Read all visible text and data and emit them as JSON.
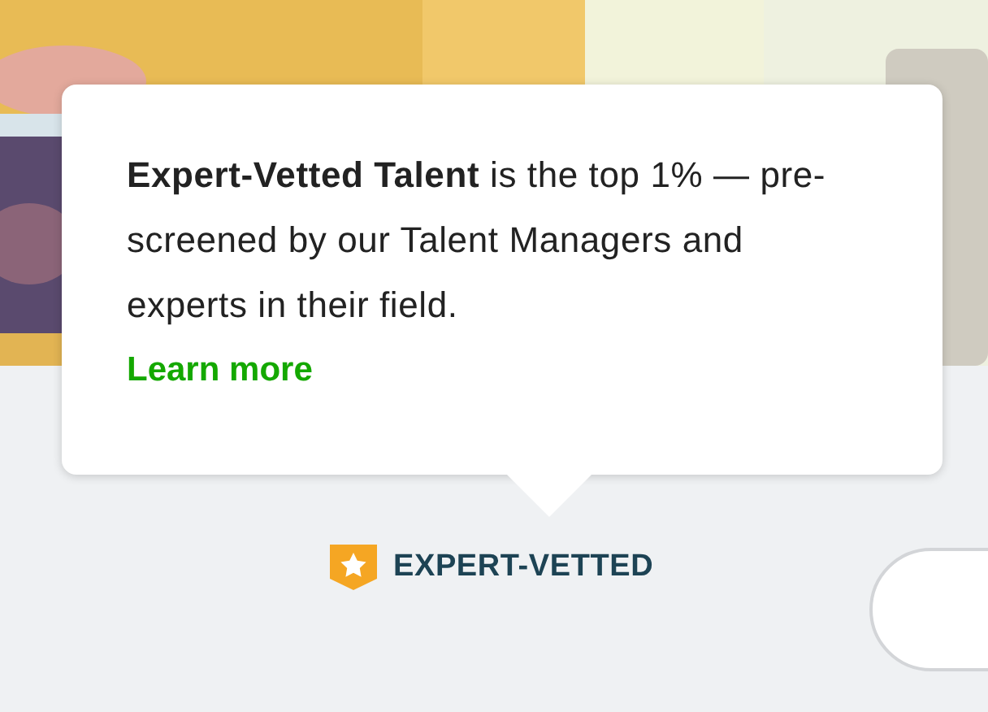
{
  "tooltip": {
    "text": "**Expert-Vetted Talent** is the top 1% — pre-screened by our Talent Managers and experts in their field.",
    "link": "Learn more"
  },
  "badge": {
    "label": "EXPERT-VETTED"
  }
}
